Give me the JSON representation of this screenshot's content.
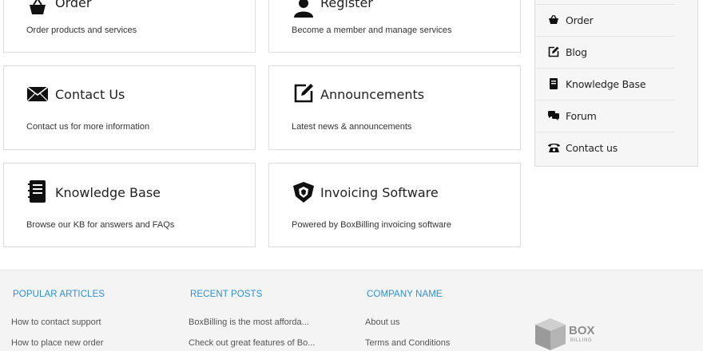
{
  "cards": [
    {
      "title": "Order",
      "desc": "Order products and services",
      "icon": "basket-icon"
    },
    {
      "title": "Register",
      "desc": "Become a member and manage services",
      "icon": "user-icon"
    },
    {
      "title": "Contact Us",
      "desc": "Contact us for more information",
      "icon": "envelope-icon"
    },
    {
      "title": "Announcements",
      "desc": "Latest news & announcements",
      "icon": "edit-icon"
    },
    {
      "title": "Knowledge Base",
      "desc": "Browse our KB for answers and FAQs",
      "icon": "book-icon"
    },
    {
      "title": "Invoicing Software",
      "desc": "Powered by BoxBilling invoicing software",
      "icon": "shield-icon"
    }
  ],
  "sidebar": {
    "items": [
      {
        "label": "Order",
        "icon": "basket-icon"
      },
      {
        "label": "Blog",
        "icon": "edit-icon"
      },
      {
        "label": "Knowledge Base",
        "icon": "book-icon"
      },
      {
        "label": "Forum",
        "icon": "comments-icon"
      },
      {
        "label": "Contact us",
        "icon": "phone-icon"
      }
    ]
  },
  "footer": {
    "popular": {
      "heading": "POPULAR ARTICLES",
      "links": [
        "How to contact support",
        "How to place new order"
      ]
    },
    "recent": {
      "heading": "RECENT POSTS",
      "links": [
        "BoxBilling is the most afforda...",
        "Check out great features of Bo..."
      ]
    },
    "company": {
      "heading": "COMPANY NAME",
      "links": [
        "About us",
        "Terms and Conditions"
      ]
    },
    "logo": {
      "line1": "BOX",
      "line2": "BILLING"
    }
  },
  "colors": {
    "accent": "#2b8fd4",
    "footer_bg": "#f4f4f4",
    "border": "#dcdcdc"
  }
}
